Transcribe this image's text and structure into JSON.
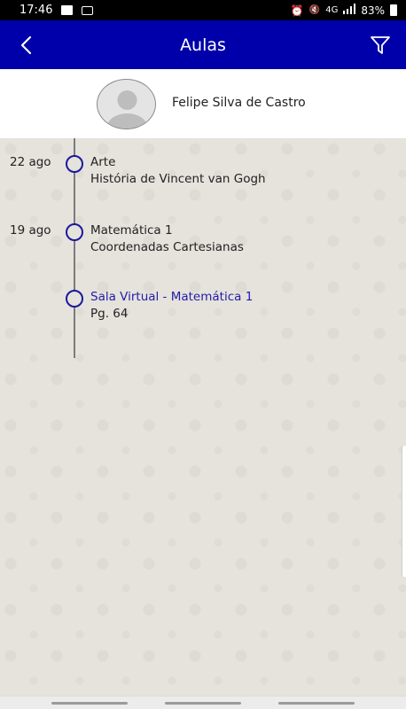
{
  "status_bar": {
    "time": "17:46",
    "battery": "83%",
    "signal_label": "4G",
    "icons": [
      "image-icon",
      "caption-icon",
      "alarm-icon",
      "mute-icon",
      "data-icon",
      "signal-icon",
      "battery-icon"
    ]
  },
  "app_bar": {
    "title": "Aulas",
    "color": "#0000aa"
  },
  "profile": {
    "name": "Felipe Silva de Castro"
  },
  "timeline": {
    "entries": [
      {
        "date": "22 ago",
        "title": "Arte",
        "subtitle": "História de Vincent van Gogh",
        "is_link": false
      },
      {
        "date": "19 ago",
        "title": "Matemática 1",
        "subtitle": "Coordenadas Cartesianas",
        "is_link": false
      },
      {
        "date": "",
        "title": "Sala Virtual - Matemática 1",
        "subtitle": "Pg. 64",
        "is_link": true
      }
    ]
  },
  "colors": {
    "accent": "#0000aa",
    "dot_border": "#1a1a9a",
    "link_text": "#2020a8"
  }
}
